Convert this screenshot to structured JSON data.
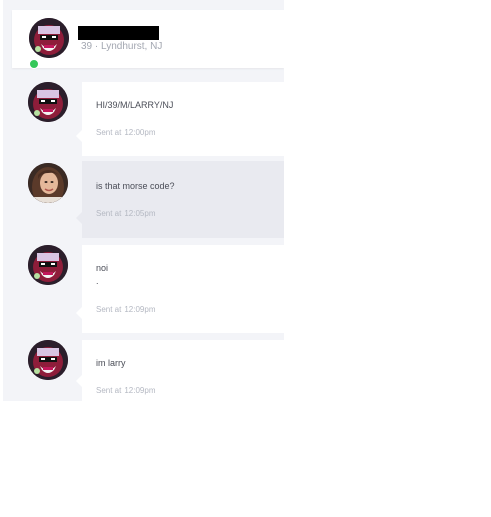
{
  "header": {
    "subtitle": "39 · Lyndhurst, NJ"
  },
  "messages": [
    {
      "avatar": "cartoon-avatar",
      "text": "HI/39/M/LARRY/NJ",
      "sent_label": "Sent at",
      "time": "12:00pm"
    },
    {
      "avatar": "photo-avatar",
      "text": "is that morse code?",
      "sent_label": "Sent at",
      "time": "12:05pm"
    },
    {
      "avatar": "cartoon-avatar",
      "text": "noi\n.",
      "sent_label": "Sent at",
      "time": "12:09pm"
    },
    {
      "avatar": "cartoon-avatar",
      "text": "im larry",
      "sent_label": "Sent at",
      "time": "12:09pm"
    }
  ],
  "colors": {
    "panel_bg": "#f3f4f8",
    "bubble_incoming": "#ffffff",
    "bubble_outgoing": "#e9eaf0",
    "online": "#34c759"
  }
}
